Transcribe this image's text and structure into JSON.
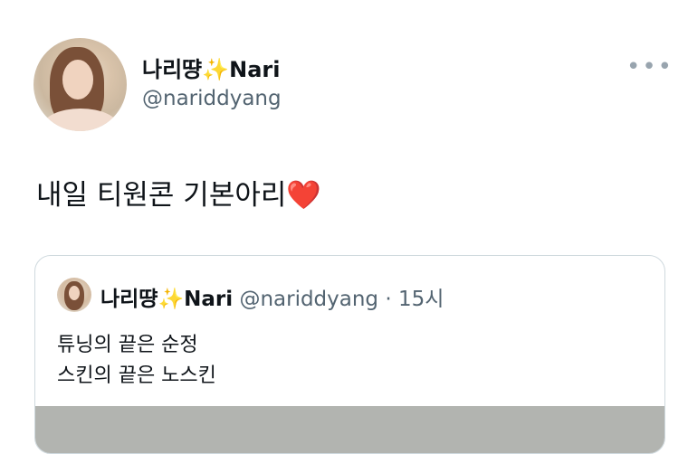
{
  "tweet": {
    "author": {
      "display_name": "나리땽",
      "display_emoji": "✨",
      "display_name_suffix": "Nari",
      "handle": "@nariddyang",
      "avatar_icon": "profile-photo"
    },
    "more_icon": "more-horizontal-icon",
    "text": "내일 티원콘 기본아리",
    "text_emoji": "❤️",
    "quoted": {
      "display_name": "나리땽",
      "display_emoji": "✨",
      "display_name_suffix": "Nari",
      "handle": "@nariddyang",
      "separator": "·",
      "time": "15시",
      "lines": [
        "튜닝의 끝은 순정",
        "스킨의 끝은 노스킨"
      ]
    }
  },
  "colors": {
    "text_primary": "#0f1419",
    "text_secondary": "#536471",
    "border": "#cfd9de",
    "sparkle": "#f7c948",
    "heart": "#e0245e"
  }
}
